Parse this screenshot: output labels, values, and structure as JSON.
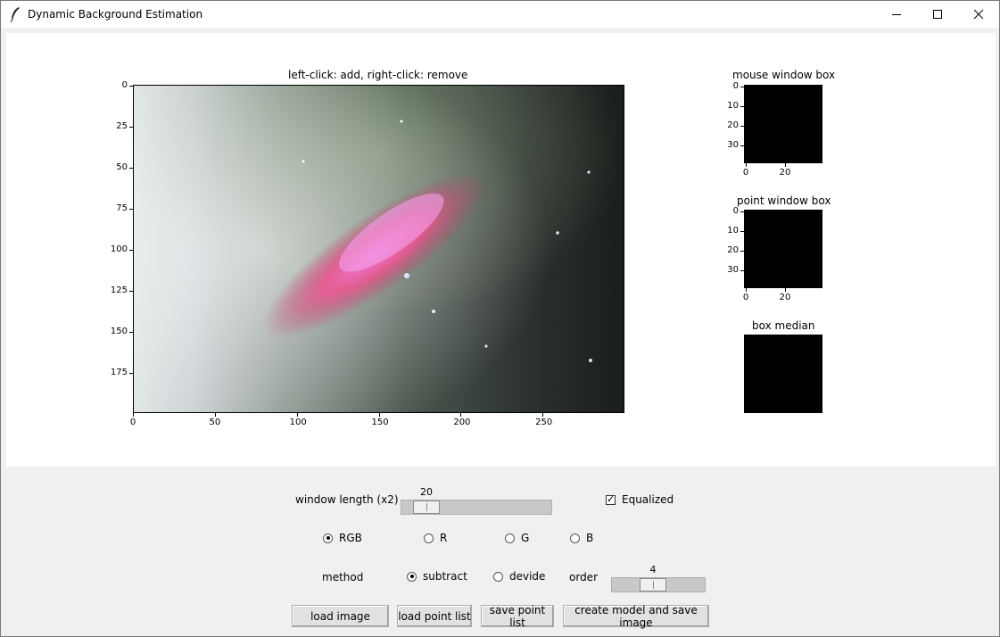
{
  "window": {
    "title": "Dynamic Background Estimation",
    "minimize_icon": "minimize-icon",
    "maximize_icon": "maximize-icon",
    "close_icon": "close-icon"
  },
  "main_plot": {
    "title": "left-click: add, right-click: remove",
    "x_ticks": [
      "0",
      "50",
      "100",
      "150",
      "200",
      "250"
    ],
    "y_ticks": [
      "0",
      "25",
      "50",
      "75",
      "100",
      "125",
      "150",
      "175"
    ]
  },
  "mouse_box": {
    "title": "mouse window box",
    "x_ticks": [
      "0",
      "20"
    ],
    "y_ticks": [
      "0",
      "10",
      "20",
      "30"
    ]
  },
  "point_box": {
    "title": "point window box",
    "x_ticks": [
      "0",
      "20"
    ],
    "y_ticks": [
      "0",
      "10",
      "20",
      "30"
    ]
  },
  "median_box": {
    "title": "box median"
  },
  "controls": {
    "window_length_label": "window length (x2)",
    "window_length_value": "20",
    "window_length_fraction": 0.1,
    "equalized_label": "Equalized",
    "equalized_checked": true,
    "channels": [
      {
        "label": "RGB",
        "checked": true
      },
      {
        "label": "R",
        "checked": false
      },
      {
        "label": "G",
        "checked": false
      },
      {
        "label": "B",
        "checked": false
      }
    ],
    "method_label": "method",
    "methods": [
      {
        "label": "subtract",
        "checked": true
      },
      {
        "label": "devide",
        "checked": false
      }
    ],
    "order_label": "order",
    "order_value": "4",
    "buttons": {
      "load_image": "load image",
      "load_point_list": "load point list",
      "save_point_list": "save point list",
      "create_model": "create model and save image"
    }
  }
}
